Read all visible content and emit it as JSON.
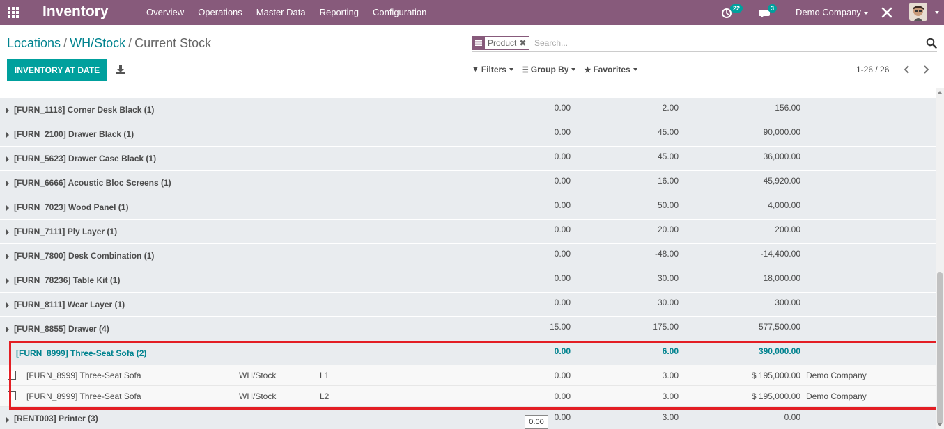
{
  "app": {
    "title": "Inventory"
  },
  "menu": [
    "Overview",
    "Operations",
    "Master Data",
    "Reporting",
    "Configuration"
  ],
  "systray": {
    "activity_count": "22",
    "chat_count": "3",
    "company": "Demo Company"
  },
  "breadcrumb": {
    "items": [
      "Locations",
      "WH/Stock"
    ],
    "current": "Current Stock"
  },
  "buttons": {
    "inventory_at_date": "INVENTORY AT DATE"
  },
  "search": {
    "facet": "Product",
    "placeholder": "Search..."
  },
  "search_options": {
    "filters": "Filters",
    "group_by": "Group By",
    "favorites": "Favorites"
  },
  "pager": {
    "value": "1-26 / 26"
  },
  "groups": [
    {
      "label": "[FURN_1118] Corner Desk Black (1)",
      "c1": "0.00",
      "c2": "2.00",
      "c3": "156.00"
    },
    {
      "label": "[FURN_2100] Drawer Black (1)",
      "c1": "0.00",
      "c2": "45.00",
      "c3": "90,000.00"
    },
    {
      "label": "[FURN_5623] Drawer Case Black (1)",
      "c1": "0.00",
      "c2": "45.00",
      "c3": "36,000.00"
    },
    {
      "label": "[FURN_6666] Acoustic Bloc Screens (1)",
      "c1": "0.00",
      "c2": "16.00",
      "c3": "45,920.00"
    },
    {
      "label": "[FURN_7023] Wood Panel (1)",
      "c1": "0.00",
      "c2": "50.00",
      "c3": "4,000.00"
    },
    {
      "label": "[FURN_7111] Ply Layer (1)",
      "c1": "0.00",
      "c2": "20.00",
      "c3": "200.00"
    },
    {
      "label": "[FURN_7800] Desk Combination (1)",
      "c1": "0.00",
      "c2": "-48.00",
      "c3": "-14,400.00"
    },
    {
      "label": "[FURN_78236] Table Kit (1)",
      "c1": "0.00",
      "c2": "30.00",
      "c3": "18,000.00"
    },
    {
      "label": "[FURN_8111] Wear Layer (1)",
      "c1": "0.00",
      "c2": "30.00",
      "c3": "300.00"
    },
    {
      "label": "[FURN_8855] Drawer (4)",
      "c1": "15.00",
      "c2": "175.00",
      "c3": "577,500.00"
    }
  ],
  "open_group": {
    "label": "[FURN_8999] Three-Seat Sofa (2)",
    "c1": "0.00",
    "c2": "6.00",
    "c3": "390,000.00"
  },
  "records": [
    {
      "product": "[FURN_8999] Three-Seat Sofa",
      "location": "WH/Stock",
      "lot": "L1",
      "reserved": "0.00",
      "quantity": "3.00",
      "value": "$ 195,000.00",
      "company": "Demo Company"
    },
    {
      "product": "[FURN_8999] Three-Seat Sofa",
      "location": "WH/Stock",
      "lot": "L2",
      "reserved": "0.00",
      "quantity": "3.00",
      "value": "$ 195,000.00",
      "company": "Demo Company"
    }
  ],
  "last_group": {
    "label": "[RENT003] Printer (3)",
    "c1": "0.00",
    "c2": "3.00",
    "c3": "0.00"
  },
  "tooltip": {
    "value": "0.00"
  }
}
